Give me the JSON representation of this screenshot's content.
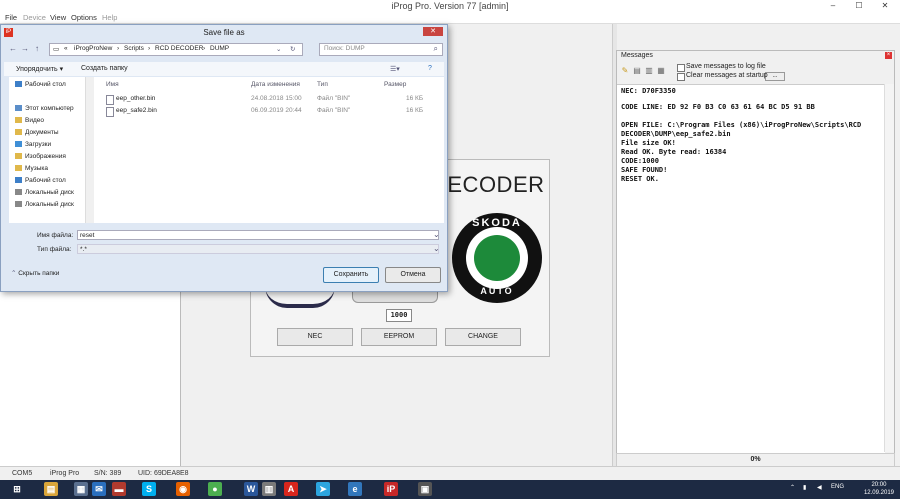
{
  "window": {
    "title": "iProg Pro. Version 77 [admin]",
    "controls": [
      "–",
      "☐",
      "✕"
    ]
  },
  "menu": [
    {
      "label": "File",
      "enabled": true
    },
    {
      "label": "Device",
      "enabled": false
    },
    {
      "label": "View",
      "enabled": true
    },
    {
      "label": "Options",
      "enabled": true
    },
    {
      "label": "Help",
      "enabled": false
    }
  ],
  "rcd": {
    "title": "DECODER",
    "logo_brand": "SKODA",
    "logo_sub": "AUTO",
    "code_value": "1000",
    "buttons": [
      "NEC",
      "EEPROM",
      "CHANGE"
    ]
  },
  "messages": {
    "title": "Messages",
    "save_log_label": "Save messages to log file",
    "clear_startup_label": "Clear messages at startup",
    "dots_label": "...",
    "lines": [
      "NEC: D70F3350",
      "",
      "CODE LINE: ED 92 F0 B3 C0 63 61 64 BC D5 91 BB",
      "",
      "OPEN FILE: C:\\Program Files (x86)\\iProgProNew\\Scripts\\RCD",
      "DECODER\\DUMP\\eep_safe2.bin",
      "File size OK!",
      "Read OK. Byte read: 16384",
      "CODE:1000",
      "SAFE FOUND!",
      "RESET OK."
    ],
    "progress_pct": 0,
    "progress_label": "0%"
  },
  "status": {
    "port": "COM5",
    "device": "iProg Pro",
    "sn": "S/N: 389",
    "uid": "UID: 69DEA8E8"
  },
  "dialog": {
    "title": "Save file as",
    "close_label": "✕",
    "path": [
      "«",
      "iProgProNew",
      "›",
      "Scripts",
      "›",
      "RCD DECODER",
      "›",
      "DUMP"
    ],
    "search_placeholder": "Поиск: DUMP",
    "organize_label": "Упорядочить ▾",
    "new_folder_label": "Создать папку",
    "nav_items": [
      {
        "label": "Рабочий стол",
        "icon": "desktop-icon",
        "color": "#3d7fc8"
      },
      {
        "label": "Этот компьютер",
        "icon": "computer-icon",
        "color": "#5b8ec9"
      },
      {
        "label": "Видео",
        "icon": "video-folder-icon",
        "color": "#e0b84a"
      },
      {
        "label": "Документы",
        "icon": "documents-folder-icon",
        "color": "#e0b84a"
      },
      {
        "label": "Загрузки",
        "icon": "downloads-folder-icon",
        "color": "#3f8fd6"
      },
      {
        "label": "Изображения",
        "icon": "pictures-folder-icon",
        "color": "#e0b84a"
      },
      {
        "label": "Музыка",
        "icon": "music-folder-icon",
        "color": "#e0b84a"
      },
      {
        "label": "Рабочий стол",
        "icon": "desktop-icon",
        "color": "#3d7fc8"
      },
      {
        "label": "Локальный диск",
        "icon": "drive-icon",
        "color": "#888888"
      },
      {
        "label": "Локальный диск",
        "icon": "drive-icon",
        "color": "#888888"
      }
    ],
    "columns": [
      "Имя",
      "Дата изменения",
      "Тип",
      "Размер"
    ],
    "files": [
      {
        "name": "eep_other.bin",
        "date": "24.08.2018 15:00",
        "type": "Файл \"BIN\"",
        "size": "16 КБ"
      },
      {
        "name": "eep_safe2.bin",
        "date": "06.09.2019 20:44",
        "type": "Файл \"BIN\"",
        "size": "16 КБ"
      }
    ],
    "filename_label": "Имя файла:",
    "filename_value": "reset",
    "filetype_label": "Тип файла:",
    "filetype_value": "*.*",
    "hide_folders_label": "Скрыть папки",
    "save_label": "Сохранить",
    "cancel_label": "Отмена"
  },
  "taskbar": {
    "apps": [
      {
        "name": "windows-start-icon",
        "glyph": "⊞",
        "color": "#1d2a43"
      },
      {
        "name": "file-explorer-icon",
        "glyph": "▤",
        "color": "#d9a53a"
      },
      {
        "name": "store-icon",
        "glyph": "▦",
        "color": "#5a6f8f"
      },
      {
        "name": "mail-icon",
        "glyph": "✉",
        "color": "#2a6fbf"
      },
      {
        "name": "flag-icon",
        "glyph": "▬",
        "color": "#b03a2e"
      },
      {
        "name": "skype-icon",
        "glyph": "S",
        "color": "#00aff0"
      },
      {
        "name": "firefox-icon",
        "glyph": "◉",
        "color": "#e66000"
      },
      {
        "name": "chrome-icon",
        "glyph": "●",
        "color": "#4caf50"
      },
      {
        "name": "word-icon",
        "glyph": "W",
        "color": "#2b579a"
      },
      {
        "name": "files-icon",
        "glyph": "▥",
        "color": "#7a7a7a"
      },
      {
        "name": "acrobat-icon",
        "glyph": "A",
        "color": "#d7261d"
      },
      {
        "name": "telegram-icon",
        "glyph": "➤",
        "color": "#2ca5e0"
      },
      {
        "name": "edge-icon",
        "glyph": "e",
        "color": "#3277bc"
      },
      {
        "name": "iprog-icon",
        "glyph": "iP",
        "color": "#c62828"
      },
      {
        "name": "viewer-icon",
        "glyph": "▣",
        "color": "#555555"
      }
    ],
    "lang": "ENG",
    "time": "20:00",
    "date": "12.09.2019"
  }
}
